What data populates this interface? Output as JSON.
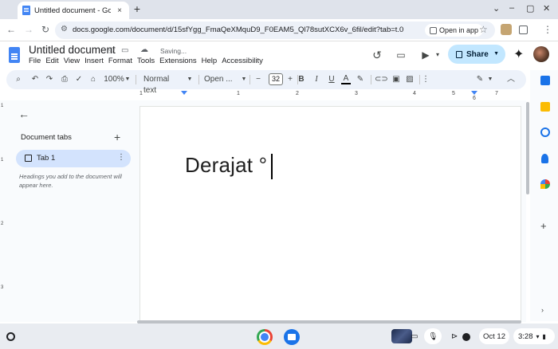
{
  "browser": {
    "tab_title": "Untitled document - Google Do",
    "tab_close": "×",
    "new_tab": "+",
    "window_controls": [
      "⌄",
      "–",
      "▢",
      "✕"
    ],
    "url": "docs.google.com/document/d/15sfYgg_FmaQeXMquD9_F0EAM5_Ql78sutXCX6v_6fil/edit?tab=t.0",
    "open_in_app": "Open in app"
  },
  "docs": {
    "title": "Untitled document",
    "saving": "Saving...",
    "menu": [
      "File",
      "Edit",
      "View",
      "Insert",
      "Format",
      "Tools",
      "Extensions",
      "Help",
      "Accessibility"
    ],
    "share": "Share"
  },
  "toolbar": {
    "zoom": "100%",
    "style": "Normal text",
    "font": "Open ...",
    "font_size": "32",
    "bold": "B",
    "italic": "I",
    "underline": "U",
    "text_color": "A"
  },
  "ruler": {
    "numbers": [
      "1",
      "1",
      "2",
      "3",
      "4",
      "5",
      "6",
      "7"
    ],
    "vnumbers": [
      "1",
      "1",
      "2",
      "3"
    ]
  },
  "sidebar": {
    "heading": "Document tabs",
    "add": "+",
    "tab_label": "Tab 1",
    "hint": "Headings you add to the document will appear here."
  },
  "document": {
    "text": "Derajat °"
  },
  "shelf": {
    "date": "Oct 12",
    "time": "3:28"
  }
}
